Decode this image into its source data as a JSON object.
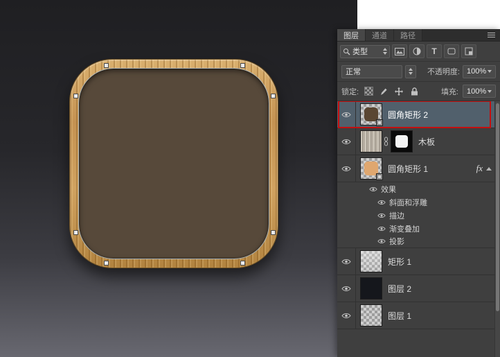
{
  "colors": {
    "accent-red": "#c40f0f",
    "panel-bg": "#3f3f3f",
    "selected-row-bg": "#51606c",
    "icon-fill": "#57493a"
  },
  "panel": {
    "tabs": {
      "layers": "图层",
      "channels": "通道",
      "paths": "路径"
    },
    "filter": {
      "kind": "类型",
      "type_icon_glyph": "T"
    },
    "blend": {
      "mode": "正常",
      "opacity_label": "不透明度:",
      "opacity_value": "100%"
    },
    "lock": {
      "label": "锁定:",
      "fill_label": "填充:",
      "fill_value": "100%"
    },
    "layers": [
      {
        "name": "圆角矩形 2"
      },
      {
        "name": "木板"
      },
      {
        "name": "圆角矩形 1",
        "fx_label": "fx",
        "effects_header": "效果",
        "effects": [
          "斜面和浮雕",
          "描边",
          "渐变叠加",
          "投影"
        ]
      },
      {
        "name": "矩形 1"
      },
      {
        "name": "图层 2"
      },
      {
        "name": "图层 1"
      }
    ]
  }
}
